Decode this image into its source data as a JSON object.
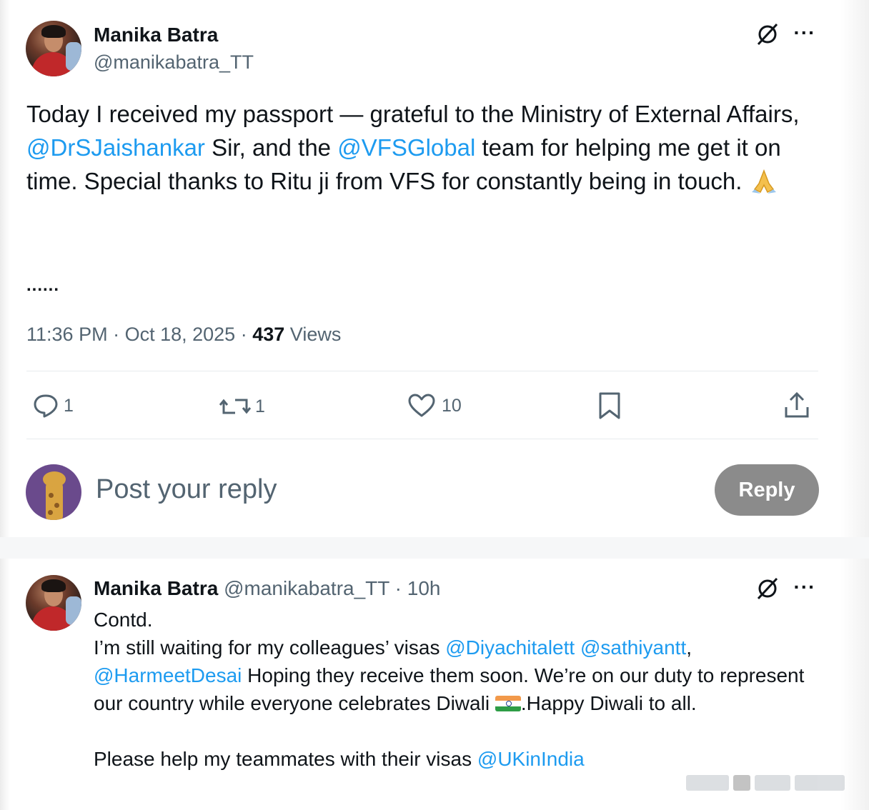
{
  "main_tweet": {
    "author_name": "Manika Batra",
    "author_handle": "@manikabatra_TT",
    "text_part1": "Today I received my passport — grateful to the Ministry of External Affairs, ",
    "mention1": "@DrSJaishankar",
    "text_part2": " Sir, and the ",
    "mention2": "@VFSGlobal",
    "text_part3": " team for helping me get it on time. Special thanks to Ritu ji from VFS for constantly being in touch. ",
    "ellipsis": "......",
    "time": "11:36 PM",
    "date": "Oct 18, 2025",
    "views_count": "437",
    "views_label": "Views"
  },
  "actions": {
    "reply_count": "1",
    "repost_count": "1",
    "like_count": "10"
  },
  "reply_composer": {
    "placeholder": "Post your reply",
    "button_label": "Reply"
  },
  "thread_tweet": {
    "author_name": "Manika Batra",
    "author_handle": "@manikabatra_TT",
    "age": "10h",
    "line1": "Contd.",
    "line2_text": "I’m still waiting for my colleagues’ visas ",
    "mention_a": "@Diyachitalett",
    "mention_b": "@sathiyantt",
    "comma": ",",
    "mention_c": "@HarmeetDesai",
    "line3_text": " Hoping they receive them soon. We’re on our duty to represent our country while everyone celebrates Diwali ",
    "line3_tail": ".Happy Diwali to all.",
    "line5_text": "Please help my teammates with their visas ",
    "mention_d": "@UKinIndia"
  },
  "icons": {
    "grok": "grok-icon",
    "more": "more-icon",
    "reply": "reply-icon",
    "repost": "repost-icon",
    "like": "heart-icon",
    "bookmark": "bookmark-icon",
    "share": "share-icon",
    "pray": "folded-hands-emoji",
    "flag": "india-flag-emoji"
  },
  "colors": {
    "link": "#1d9bf0",
    "secondary_text": "#536471",
    "reply_button_bg": "#8b8b8b"
  }
}
